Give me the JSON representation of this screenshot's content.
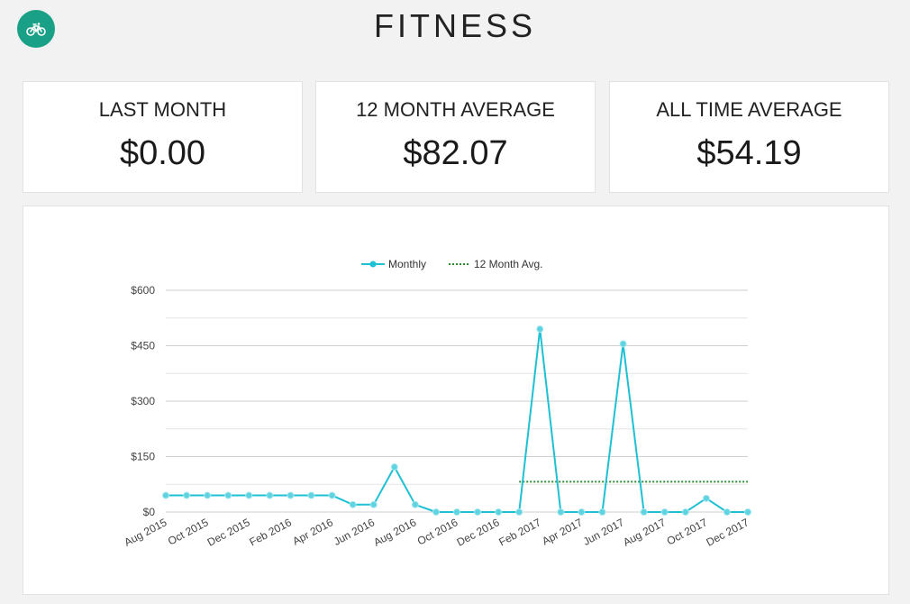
{
  "header": {
    "title": "FITNESS",
    "icon": "bicycle-icon"
  },
  "stats": [
    {
      "label": "LAST MONTH",
      "value": "$0.00"
    },
    {
      "label": "12 MONTH AVERAGE",
      "value": "$82.07"
    },
    {
      "label": "ALL TIME AVERAGE",
      "value": "$54.19"
    }
  ],
  "colors": {
    "accent": "#1aa086",
    "monthly": "#1ec0d4",
    "average": "#2e8b2e"
  },
  "chart_data": {
    "type": "line",
    "ylim": [
      0,
      600
    ],
    "y_ticks": [
      "$0",
      "$150",
      "$300",
      "$450",
      "$600"
    ],
    "x_tick_labels": [
      "Aug 2015",
      "Oct 2015",
      "Dec 2015",
      "Feb 2016",
      "Apr 2016",
      "Jun 2016",
      "Aug 2016",
      "Oct 2016",
      "Dec 2016",
      "Feb 2017",
      "Apr 2017",
      "Jun 2017",
      "Aug 2017",
      "Oct 2017",
      "Dec 2017"
    ],
    "grid": true,
    "legend_position": "top",
    "categories": [
      "Aug 2015",
      "Sep 2015",
      "Oct 2015",
      "Nov 2015",
      "Dec 2015",
      "Jan 2016",
      "Feb 2016",
      "Mar 2016",
      "Apr 2016",
      "May 2016",
      "Jun 2016",
      "Jul 2016",
      "Aug 2016",
      "Sep 2016",
      "Oct 2016",
      "Nov 2016",
      "Dec 2016",
      "Jan 2017",
      "Feb 2017",
      "Mar 2017",
      "Apr 2017",
      "May 2017",
      "Jun 2017",
      "Jul 2017",
      "Aug 2017",
      "Sep 2017",
      "Oct 2017",
      "Nov 2017",
      "Dec 2017"
    ],
    "series": [
      {
        "name": "Monthly",
        "values": [
          45,
          45,
          45,
          45,
          45,
          45,
          45,
          45,
          45,
          20,
          20,
          122,
          20,
          0,
          0,
          0,
          0,
          0,
          495,
          0,
          0,
          0,
          455,
          0,
          0,
          0,
          37,
          0,
          0
        ]
      },
      {
        "name": "12 Month Avg.",
        "start": "Jan 2017",
        "end": "Dec 2017",
        "value": 82.07
      }
    ]
  }
}
